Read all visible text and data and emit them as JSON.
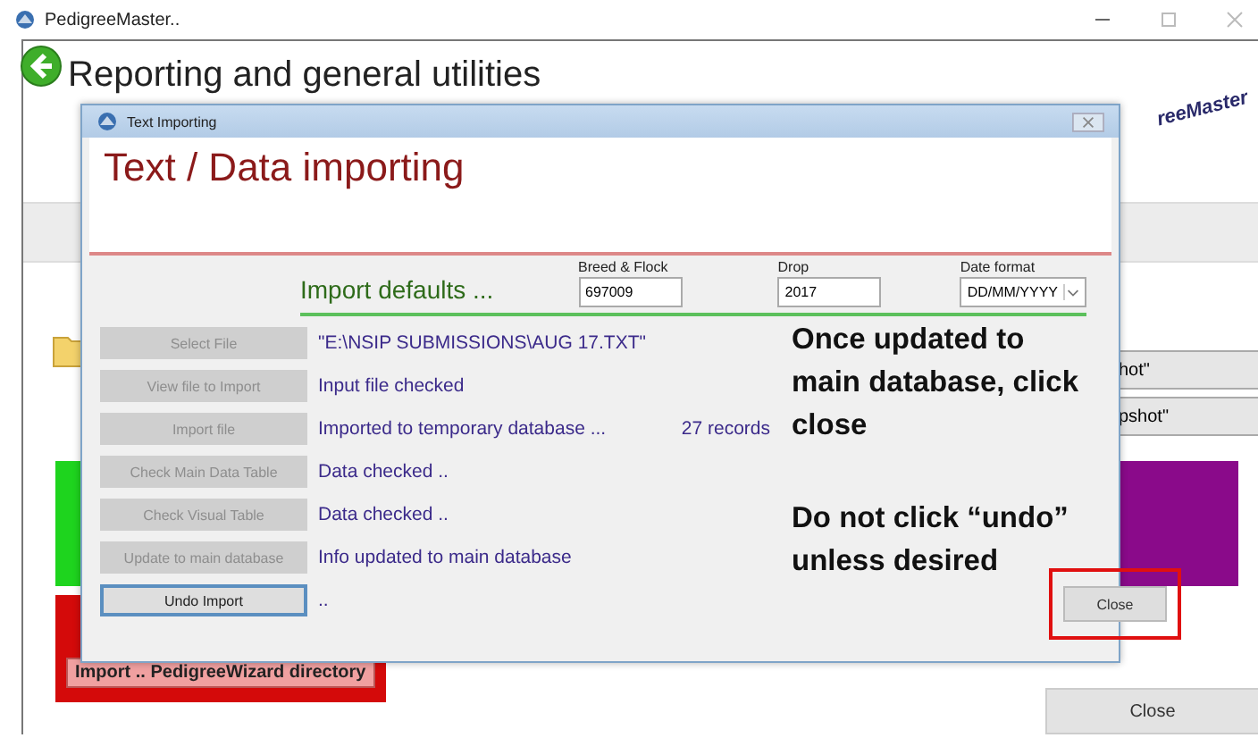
{
  "window": {
    "title": "PedigreeMaster.."
  },
  "main": {
    "heading": "Reporting and general utilities",
    "logo": "reeMaster",
    "side_buttons": [
      "hot\"",
      "pshot\""
    ],
    "red_panel_button": "Import .. PedigreeWizard directory",
    "close_button": "Close"
  },
  "dialog": {
    "title": "Text Importing",
    "heading": "Text / Data importing",
    "defaults_label": "Import defaults ...",
    "fields": [
      {
        "label": "Breed & Flock",
        "value": "697009",
        "kind": "text"
      },
      {
        "label": "Drop",
        "value": "2017",
        "kind": "text"
      },
      {
        "label": "Date format",
        "value": "DD/MM/YYYY",
        "kind": "select"
      }
    ],
    "steps": [
      {
        "button": "Select File",
        "status": "\"E:\\NSIP SUBMISSIONS\\AUG 17.TXT\"",
        "disabled": true
      },
      {
        "button": "View file to Import",
        "status": "Input file checked",
        "disabled": true
      },
      {
        "button": "Import file",
        "status": "Imported to temporary database ...",
        "extra": "27 records",
        "disabled": true
      },
      {
        "button": "Check Main Data Table",
        "status": "Data checked ..",
        "disabled": true
      },
      {
        "button": "Check Visual Table",
        "status": "Data checked ..",
        "disabled": true
      },
      {
        "button": "Update to main database",
        "status": "Info updated to main database",
        "disabled": true
      },
      {
        "button": "Undo Import",
        "status": "..",
        "disabled": false
      }
    ],
    "notes": [
      "Once updated to main database, click close",
      "Do not click “undo” unless desired"
    ],
    "close_button": "Close",
    "close_highlighted": true
  }
}
